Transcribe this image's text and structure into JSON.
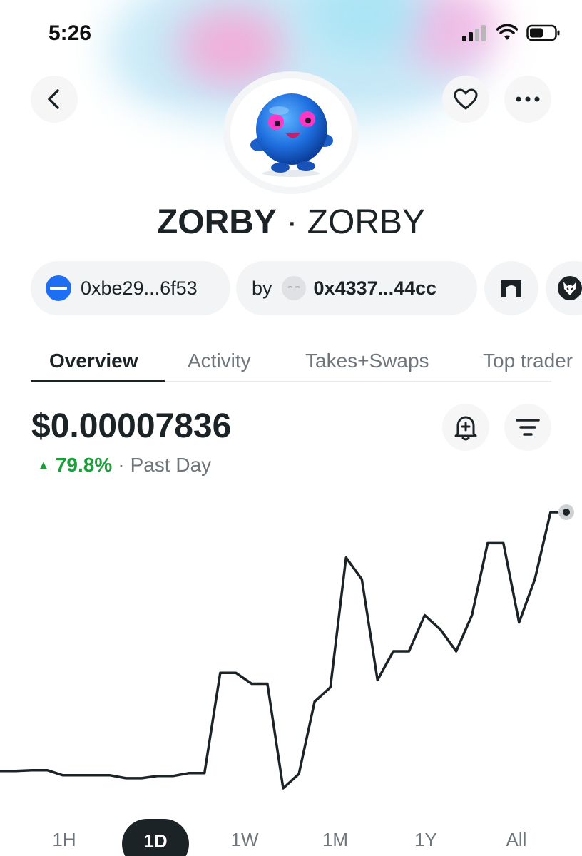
{
  "status_bar": {
    "time": "5:26"
  },
  "token": {
    "name": "ZORBY",
    "separator": "·",
    "symbol": "ZORBY"
  },
  "chips": {
    "contract": "0xbe29...6f53",
    "creator_prefix": "by",
    "creator": "0x4337...44cc"
  },
  "tabs": [
    "Overview",
    "Activity",
    "Takes+Swaps",
    "Top trader"
  ],
  "price": {
    "value": "$0.00007836",
    "change": "79.8%",
    "separator": "·",
    "period": "Past Day",
    "direction_icon": "▲"
  },
  "colors": {
    "positive": "#1a9f3a",
    "line": "#1c2327",
    "accent_blue": "#1d6ef2"
  },
  "time_ranges": [
    "1H",
    "1D",
    "1W",
    "1M",
    "1Y",
    "All"
  ],
  "selected_range": "1D",
  "chart_data": {
    "type": "line",
    "title": "",
    "xlabel": "",
    "ylabel": "",
    "grid": false,
    "legend": "none",
    "series": [
      {
        "values": [
          4.24e-05,
          4.24e-05,
          4.25e-05,
          4.25e-05,
          4.18e-05,
          4.18e-05,
          4.18e-05,
          4.18e-05,
          4.14e-05,
          4.14e-05,
          4.17e-05,
          4.17e-05,
          4.21e-05,
          4.21e-05,
          5.6e-05,
          5.6e-05,
          5.45e-05,
          5.45e-05,
          4e-05,
          4.2e-05,
          5.2e-05,
          5.4e-05,
          7.2e-05,
          6.9e-05,
          5.5e-05,
          5.9e-05,
          5.9e-05,
          6.4e-05,
          6.2e-05,
          5.9e-05,
          6.4e-05,
          7.4e-05,
          7.4e-05,
          6.3e-05,
          6.9e-05,
          7.83e-05,
          7.83e-05
        ]
      }
    ]
  }
}
